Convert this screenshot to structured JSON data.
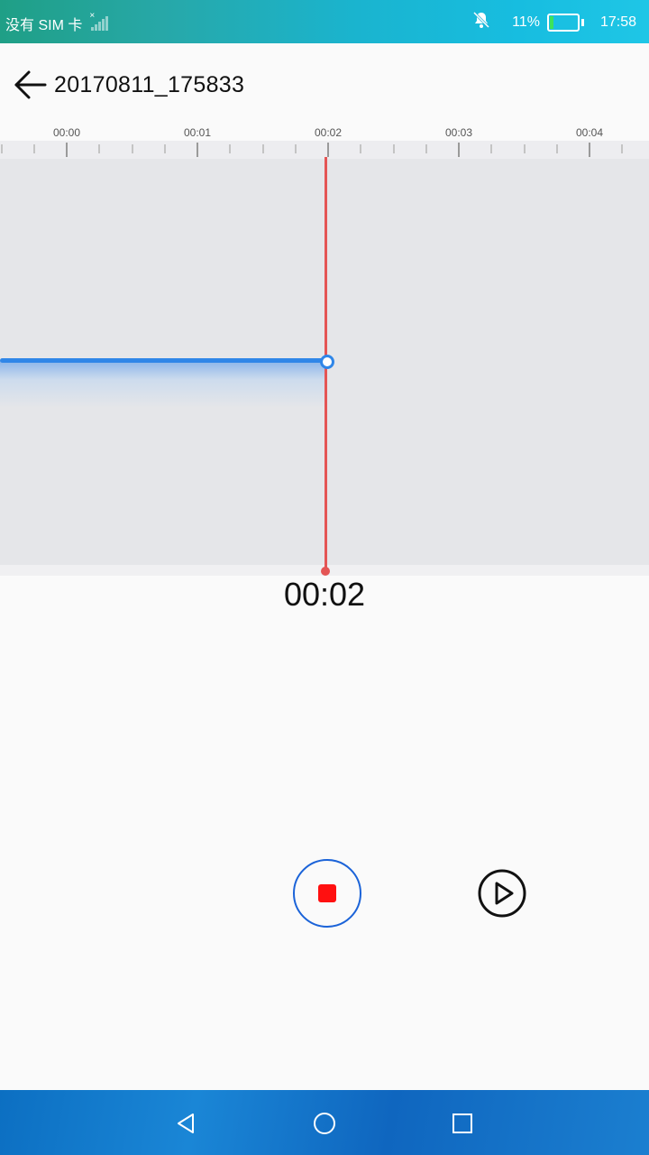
{
  "status_bar": {
    "carrier": "没有 SIM 卡",
    "battery_percent": "11%",
    "battery_level": 0.11,
    "time": "17:58",
    "icons": [
      "no-sim-signal-icon",
      "bell-off-icon",
      "battery-icon"
    ]
  },
  "header": {
    "back_icon": "arrow-left-icon",
    "title": "20170811_175833"
  },
  "timeline": {
    "ticks": [
      "00:00",
      "00:01",
      "00:02",
      "00:03",
      "00:04"
    ]
  },
  "timer": "00:02",
  "controls": {
    "stop_icon": "stop-icon",
    "play_icon": "play-icon"
  },
  "nav": {
    "icons": [
      "back-triangle-icon",
      "home-circle-icon",
      "recents-square-icon"
    ]
  },
  "colors": {
    "accent": "#1b63d8",
    "record_red": "#ff1010",
    "cursor": "#e45555",
    "wave": "#2f86e8"
  }
}
